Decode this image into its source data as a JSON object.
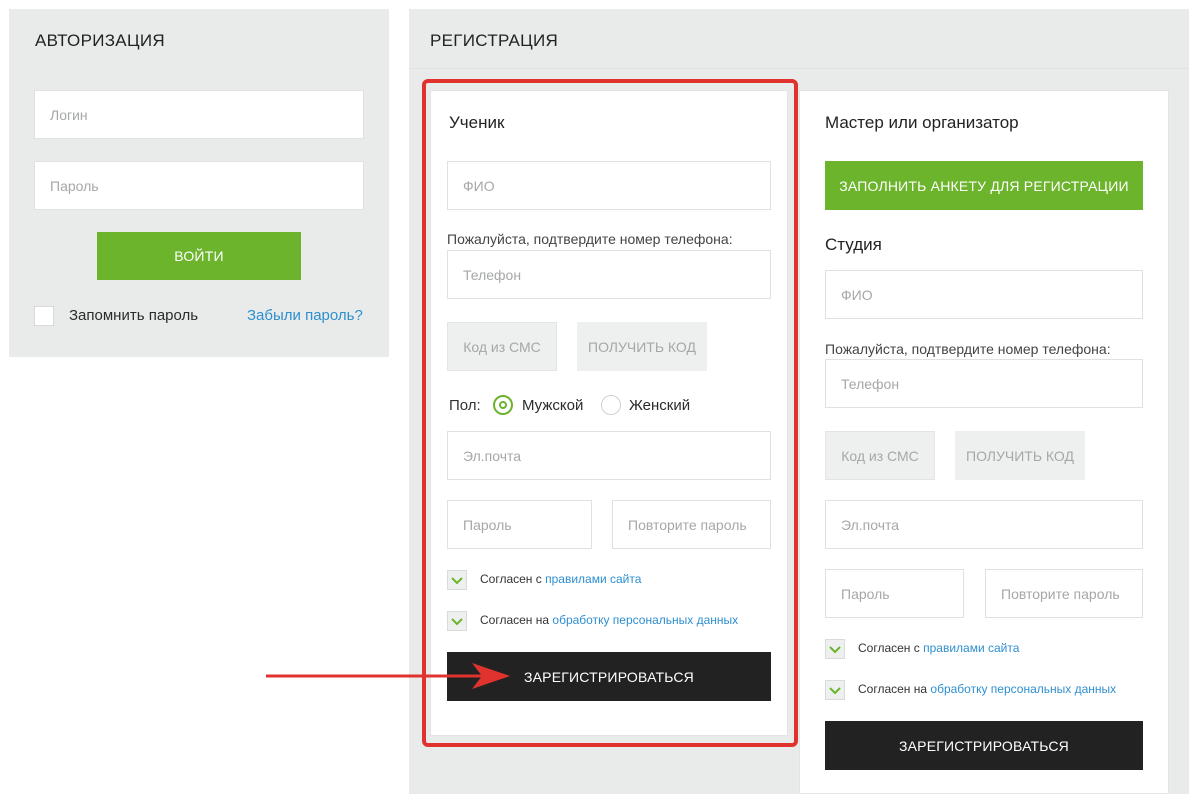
{
  "auth": {
    "title": "АВТОРИЗАЦИЯ",
    "login_placeholder": "Логин",
    "password_placeholder": "Пароль",
    "submit_label": "ВОЙТИ",
    "remember_label": "Запомнить пароль",
    "forgot_label": "Забыли пароль?"
  },
  "registration": {
    "title": "РЕГИСТРАЦИЯ",
    "student": {
      "title": "Ученик",
      "fio_placeholder": "ФИО",
      "phone_prompt": "Пожалуйста, подтвердите номер телефона:",
      "phone_placeholder": "Телефон",
      "sms_placeholder": "Код из СМС",
      "get_code_label": "ПОЛУЧИТЬ КОД",
      "gender_label": "Пол:",
      "gender_male": "Мужской",
      "gender_female": "Женский",
      "gender_selected": "Мужской",
      "email_placeholder": "Эл.почта",
      "password_placeholder": "Пароль",
      "password_repeat_placeholder": "Повторите пароль",
      "agree_rules_prefix": "Согласен с ",
      "agree_rules_link": "правилами сайта",
      "agree_data_prefix": "Согласен на ",
      "agree_data_link": "обработку персональных данных",
      "submit_label": "ЗАРЕГИСТРИРОВАТЬСЯ"
    },
    "master": {
      "title": "Мастер или организатор",
      "fill_form_label": "ЗАПОЛНИТЬ АНКЕТУ ДЛЯ РЕГИСТРАЦИИ"
    },
    "studio": {
      "title": "Студия",
      "fio_placeholder": "ФИО",
      "phone_prompt": "Пожалуйста, подтвердите номер телефона:",
      "phone_placeholder": "Телефон",
      "sms_placeholder": "Код из СМС",
      "get_code_label": "ПОЛУЧИТЬ КОД",
      "email_placeholder": "Эл.почта",
      "password_placeholder": "Пароль",
      "password_repeat_placeholder": "Повторите пароль",
      "agree_rules_prefix": "Согласен с ",
      "agree_rules_link": "правилами сайта",
      "agree_data_prefix": "Согласен на ",
      "agree_data_link": "обработку персональных данных",
      "submit_label": "ЗАРЕГИСТРИРОВАТЬСЯ"
    }
  },
  "colors": {
    "accent_green": "#6bb42c",
    "annotation_red": "#e0332d",
    "link_blue": "#2f8fd0",
    "panel_grey": "#e8ebea"
  }
}
